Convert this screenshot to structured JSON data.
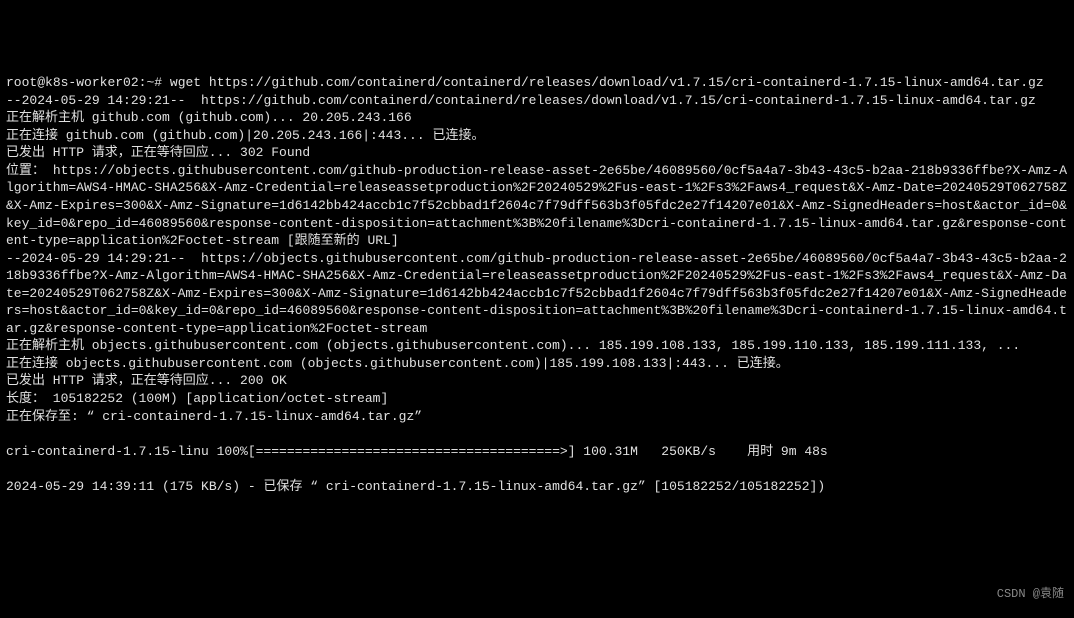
{
  "prompt": {
    "user": "root",
    "host": "k8s-worker02",
    "cwd": "~",
    "symbol": "#",
    "command": "wget https://github.com/containerd/containerd/releases/download/v1.7.15/cri-containerd-1.7.15-linux-amd64.tar.gz"
  },
  "output": {
    "ts1": "--2024-05-29 14:29:21--  https://github.com/containerd/containerd/releases/download/v1.7.15/cri-containerd-1.7.15-linux-amd64.tar.gz",
    "resolve1": "正在解析主机 github.com (github.com)... 20.205.243.166",
    "connect1": "正在连接 github.com (github.com)|20.205.243.166|:443... 已连接。",
    "request1": "已发出 HTTP 请求，正在等待回应... 302 Found",
    "location_label": "位置：",
    "location_url": "https://objects.githubusercontent.com/github-production-release-asset-2e65be/46089560/0cf5a4a7-3b43-43c5-b2aa-218b9336ffbe?X-Amz-Algorithm=AWS4-HMAC-SHA256&X-Amz-Credential=releaseassetproduction%2F20240529%2Fus-east-1%2Fs3%2Faws4_request&X-Amz-Date=20240529T062758Z&X-Amz-Expires=300&X-Amz-Signature=1d6142bb424accb1c7f52cbbad1f2604c7f79dff563b3f05fdc2e27f14207e01&X-Amz-SignedHeaders=host&actor_id=0&key_id=0&repo_id=46089560&response-content-disposition=attachment%3B%20filename%3Dcri-containerd-1.7.15-linux-amd64.tar.gz&response-content-type=application%2Foctet-stream",
    "follow_new": " [跟随至新的 URL]",
    "ts2": "--2024-05-29 14:29:21--  https://objects.githubusercontent.com/github-production-release-asset-2e65be/46089560/0cf5a4a7-3b43-43c5-b2aa-218b9336ffbe?X-Amz-Algorithm=AWS4-HMAC-SHA256&X-Amz-Credential=releaseassetproduction%2F20240529%2Fus-east-1%2Fs3%2Faws4_request&X-Amz-Date=20240529T062758Z&X-Amz-Expires=300&X-Amz-Signature=1d6142bb424accb1c7f52cbbad1f2604c7f79dff563b3f05fdc2e27f14207e01&X-Amz-SignedHeaders=host&actor_id=0&key_id=0&repo_id=46089560&response-content-disposition=attachment%3B%20filename%3Dcri-containerd-1.7.15-linux-amd64.tar.gz&response-content-type=application%2Foctet-stream",
    "resolve2": "正在解析主机 objects.githubusercontent.com (objects.githubusercontent.com)... 185.199.108.133, 185.199.110.133, 185.199.111.133, ...",
    "connect2": "正在连接 objects.githubusercontent.com (objects.githubusercontent.com)|185.199.108.133|:443... 已连接。",
    "request2": "已发出 HTTP 请求，正在等待回应... 200 OK",
    "length": "长度： 105182252 (100M) [application/octet-stream]",
    "saving": "正在保存至: “ cri-containerd-1.7.15-linux-amd64.tar.gz”",
    "progress": "cri-containerd-1.7.15-linu 100%[=======================================>] 100.31M   250KB/s    用时 9m 48s",
    "final": "2024-05-29 14:39:11 (175 KB/s) - 已保存 “ cri-containerd-1.7.15-linux-amd64.tar.gz” [105182252/105182252])"
  },
  "watermark": "CSDN @袁随"
}
